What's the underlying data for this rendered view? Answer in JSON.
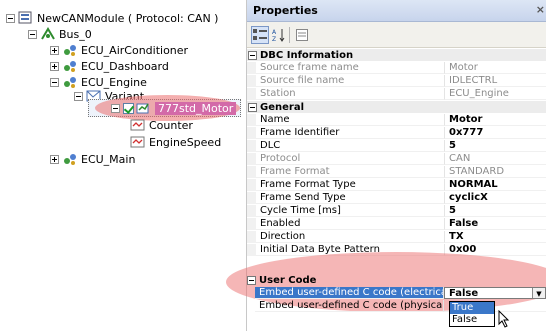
{
  "tree": {
    "root": "NewCANModule ( Protocol: CAN )",
    "bus": "Bus_0",
    "ecus": [
      "ECU_AirConditioner",
      "ECU_Dashboard",
      "ECU_Engine"
    ],
    "variant": "Variant",
    "selected_frame": "777std_Motor",
    "signals": [
      "Counter",
      "EngineSpeed"
    ],
    "last_ecu": "ECU_Main"
  },
  "properties": {
    "title": "Properties",
    "close_glyph": "×",
    "categories": {
      "dbc": "DBC Information",
      "general": "General",
      "user_code": "User Code"
    },
    "dbc_rows": [
      {
        "name": "Source frame name",
        "value": "Motor"
      },
      {
        "name": "Source file name",
        "value": "IDLECTRL"
      },
      {
        "name": "Station",
        "value": "ECU_Engine"
      }
    ],
    "general_rows": [
      {
        "name": "Name",
        "value": "Motor"
      },
      {
        "name": "Frame Identifier",
        "value": "0x777"
      },
      {
        "name": "DLC",
        "value": "5"
      },
      {
        "name": "Protocol",
        "value": "CAN"
      },
      {
        "name": "Frame Format",
        "value": "STANDARD"
      },
      {
        "name": "Frame Format Type",
        "value": "NORMAL"
      },
      {
        "name": "Frame Send Type",
        "value": "cyclicX"
      },
      {
        "name": "Cycle Time [ms]",
        "value": "5"
      },
      {
        "name": "Enabled",
        "value": "False"
      },
      {
        "name": "Direction",
        "value": "TX"
      },
      {
        "name": "Initial Data Byte Pattern",
        "value": "0x00"
      }
    ],
    "user_code_rows": [
      {
        "name": "Embed user-defined C code (electrical)",
        "value": "False"
      },
      {
        "name": "Embed user-defined C code (physical)",
        "value": ""
      }
    ],
    "dropdown_options": [
      "True",
      "False"
    ]
  },
  "colors": {
    "selection": "#3a77c9",
    "highlight_ellipse": "#eb6e6e",
    "tree_selected": "#d36aa8"
  }
}
